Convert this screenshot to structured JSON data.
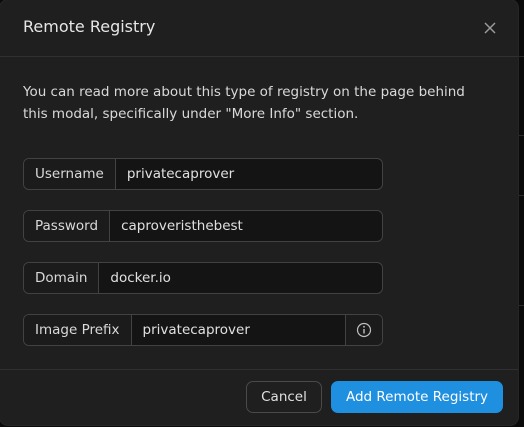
{
  "modal": {
    "title": "Remote Registry",
    "close_icon": "close-icon",
    "description": "You can read more about this type of registry on the page behind this modal, specifically under \"More Info\" section."
  },
  "form": {
    "username": {
      "label": "Username",
      "value": "privatecaprover"
    },
    "password": {
      "label": "Password",
      "value": "caproveristhebest"
    },
    "domain": {
      "label": "Domain",
      "value": "docker.io"
    },
    "image_prefix": {
      "label": "Image Prefix",
      "value": "privatecaprover",
      "suffix_icon": "info-circle-icon"
    }
  },
  "footer": {
    "cancel_label": "Cancel",
    "submit_label": "Add Remote Registry"
  },
  "colors": {
    "primary": "#1f8fe0",
    "modal_bg": "#1f1f1f",
    "border": "#424242"
  }
}
